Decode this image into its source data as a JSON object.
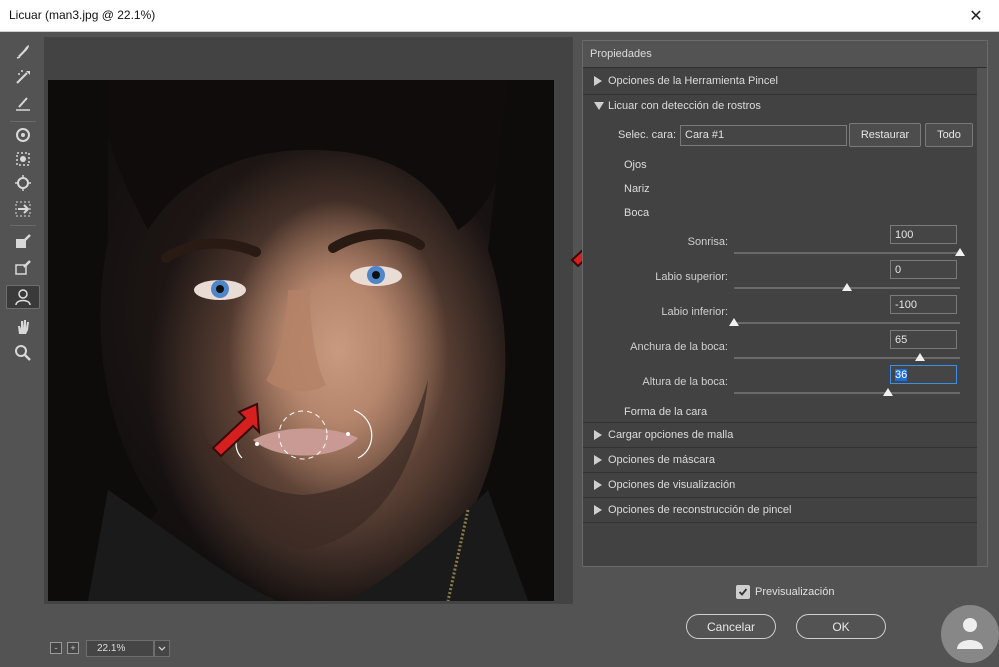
{
  "window": {
    "title": "Licuar (man3.jpg @ 22.1%)",
    "close_glyph": "✕"
  },
  "toolbar": {
    "tools": [
      {
        "name": "forward-warp-icon"
      },
      {
        "name": "reconstruct-icon"
      },
      {
        "name": "smooth-icon"
      },
      {
        "name": "twirl-icon"
      },
      {
        "name": "pucker-icon"
      },
      {
        "name": "bloat-icon"
      },
      {
        "name": "push-left-icon"
      },
      {
        "name": "freeze-mask-icon"
      },
      {
        "name": "thaw-mask-icon"
      },
      {
        "name": "face-tool-icon",
        "active": true
      },
      {
        "name": "hand-icon"
      },
      {
        "name": "zoom-icon"
      }
    ]
  },
  "zoom": {
    "minus": "-",
    "plus": "+",
    "value": "22.1%"
  },
  "panel": {
    "header": "Propiedades",
    "sections": {
      "brush": "Opciones de la Herramienta Pincel",
      "face_aware": "Licuar con detección de rostros",
      "mesh": "Cargar opciones de malla",
      "mask": "Opciones de máscara",
      "view": "Opciones de visualización",
      "brush_reconstruct": "Opciones de reconstrucción de pincel"
    },
    "select_face": {
      "label": "Selec. cara:",
      "value": "Cara #1"
    },
    "buttons": {
      "reset": "Restaurar",
      "all": "Todo"
    },
    "subsections": {
      "eyes": "Ojos",
      "nose": "Nariz",
      "mouth": "Boca",
      "face_shape": "Forma de la cara"
    },
    "sliders": [
      {
        "label": "Sonrisa:",
        "value": "100",
        "level": 1.0
      },
      {
        "label": "Labio superior:",
        "value": "0",
        "level": 0.5
      },
      {
        "label": "Labio inferior:",
        "value": "-100",
        "level": 0.0
      },
      {
        "label": "Anchura de la boca:",
        "value": "65",
        "level": 0.825
      },
      {
        "label": "Altura de la boca:",
        "value": "36",
        "level": 0.68,
        "focused": true
      }
    ]
  },
  "footer": {
    "preview_label": "Previsualización",
    "preview_checked": true,
    "cancel": "Cancelar",
    "ok": "OK"
  },
  "colors": {
    "accent": "#1e6fd9",
    "arrow": "#d61f1f",
    "panel": "#424242",
    "bg": "#535353"
  }
}
